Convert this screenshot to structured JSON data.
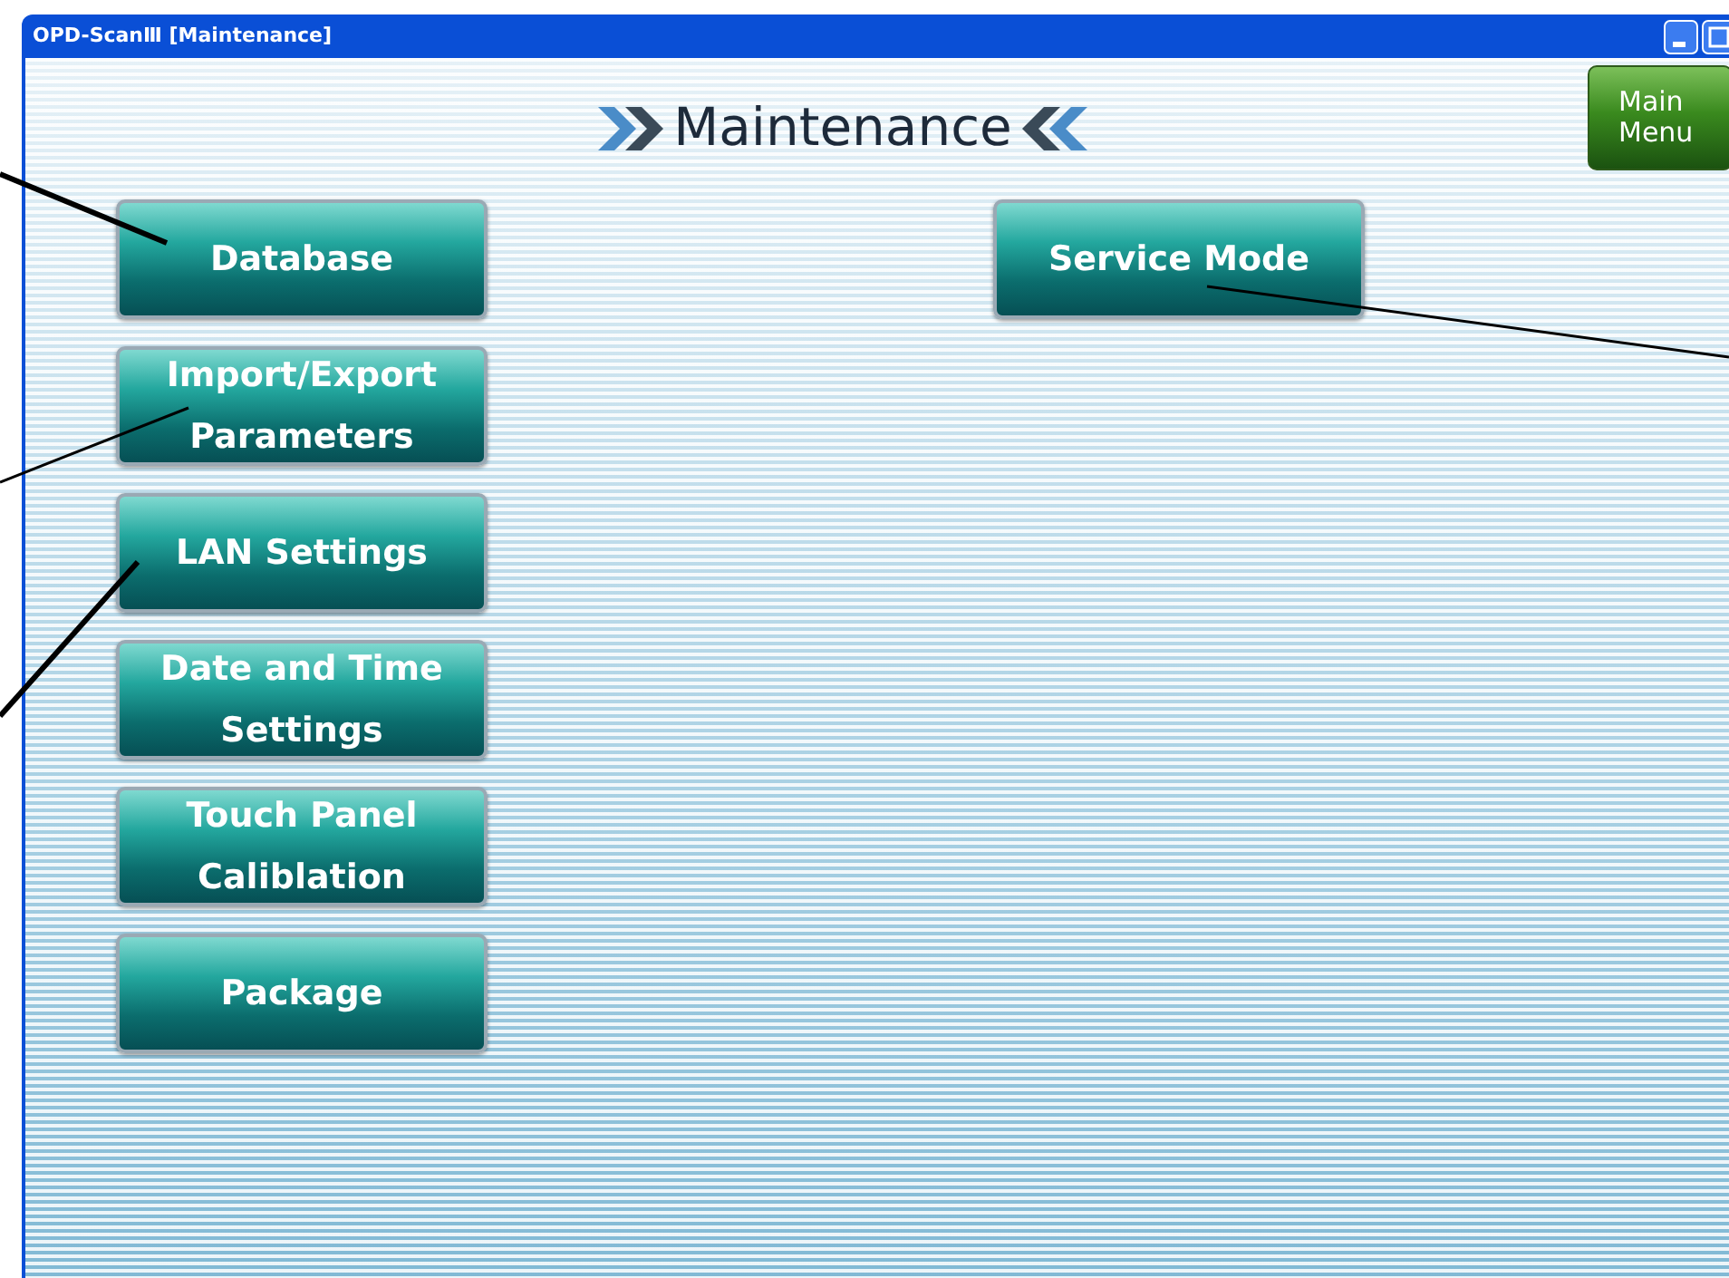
{
  "window": {
    "title": "OPD-ScanⅢ [Maintenance]"
  },
  "header": {
    "title": "Maintenance",
    "main_menu": [
      "Main",
      "Menu"
    ]
  },
  "left_buttons": [
    {
      "lines": [
        "Database"
      ]
    },
    {
      "lines": [
        "Import/Export",
        "Parameters"
      ]
    },
    {
      "lines": [
        "LAN Settings"
      ]
    },
    {
      "lines": [
        "Date and Time",
        "Settings"
      ]
    },
    {
      "lines": [
        "Touch Panel",
        "Caliblation"
      ]
    },
    {
      "lines": [
        "Package"
      ]
    }
  ],
  "right_buttons": [
    {
      "lines": [
        "Service Mode"
      ]
    }
  ]
}
